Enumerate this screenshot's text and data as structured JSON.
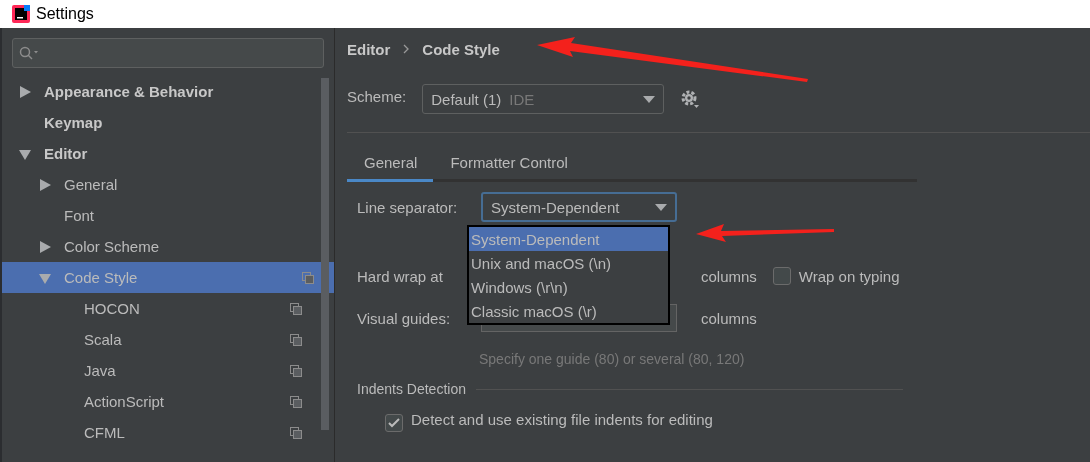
{
  "window": {
    "title": "Settings"
  },
  "tree": [
    {
      "label": "Appearance & Behavior",
      "expanded": false,
      "selected": false
    },
    {
      "label": "Keymap",
      "selected": false
    },
    {
      "label": "Editor",
      "expanded": true,
      "selected": false,
      "children": [
        {
          "label": "General",
          "expanded": false,
          "selected": false
        },
        {
          "label": "Font",
          "selected": false
        },
        {
          "label": "Color Scheme",
          "expanded": false,
          "selected": false
        },
        {
          "label": "Code Style",
          "expanded": true,
          "selected": true,
          "scheme_icon": true,
          "children": [
            {
              "label": "HOCON",
              "selected": false,
              "scheme_icon": true
            },
            {
              "label": "Scala",
              "selected": false,
              "scheme_icon": true
            },
            {
              "label": "Java",
              "selected": false,
              "scheme_icon": true
            },
            {
              "label": "ActionScript",
              "selected": false,
              "scheme_icon": true
            },
            {
              "label": "CFML",
              "selected": false,
              "scheme_icon": true
            }
          ]
        }
      ]
    }
  ],
  "breadcrumb": [
    "Editor",
    "Code Style"
  ],
  "scheme": {
    "label": "Scheme:",
    "value": "Default (1)",
    "tag": "IDE"
  },
  "tabs": [
    {
      "label": "General",
      "selected": true
    },
    {
      "label": "Formatter Control",
      "selected": false
    }
  ],
  "line_separator": {
    "label": "Line separator:",
    "value": "System-Dependent",
    "options": [
      {
        "label": "System-Dependent",
        "selected": true
      },
      {
        "label": "Unix and macOS (\\n)",
        "selected": false
      },
      {
        "label": "Windows (\\r\\n)",
        "selected": false
      },
      {
        "label": "Classic macOS (\\r)",
        "selected": false
      }
    ]
  },
  "hard_wrap": {
    "label": "Hard wrap at",
    "unit": "columns",
    "wrap_on_typing": {
      "label": "Wrap on typing",
      "checked": false
    }
  },
  "visual_guides": {
    "label": "Visual guides:",
    "unit": "columns",
    "hint": "Specify one guide (80) or several (80, 120)"
  },
  "indents_detection": {
    "title": "Indents Detection",
    "detect": {
      "label": "Detect and use existing file indents for editing",
      "checked": true
    }
  }
}
